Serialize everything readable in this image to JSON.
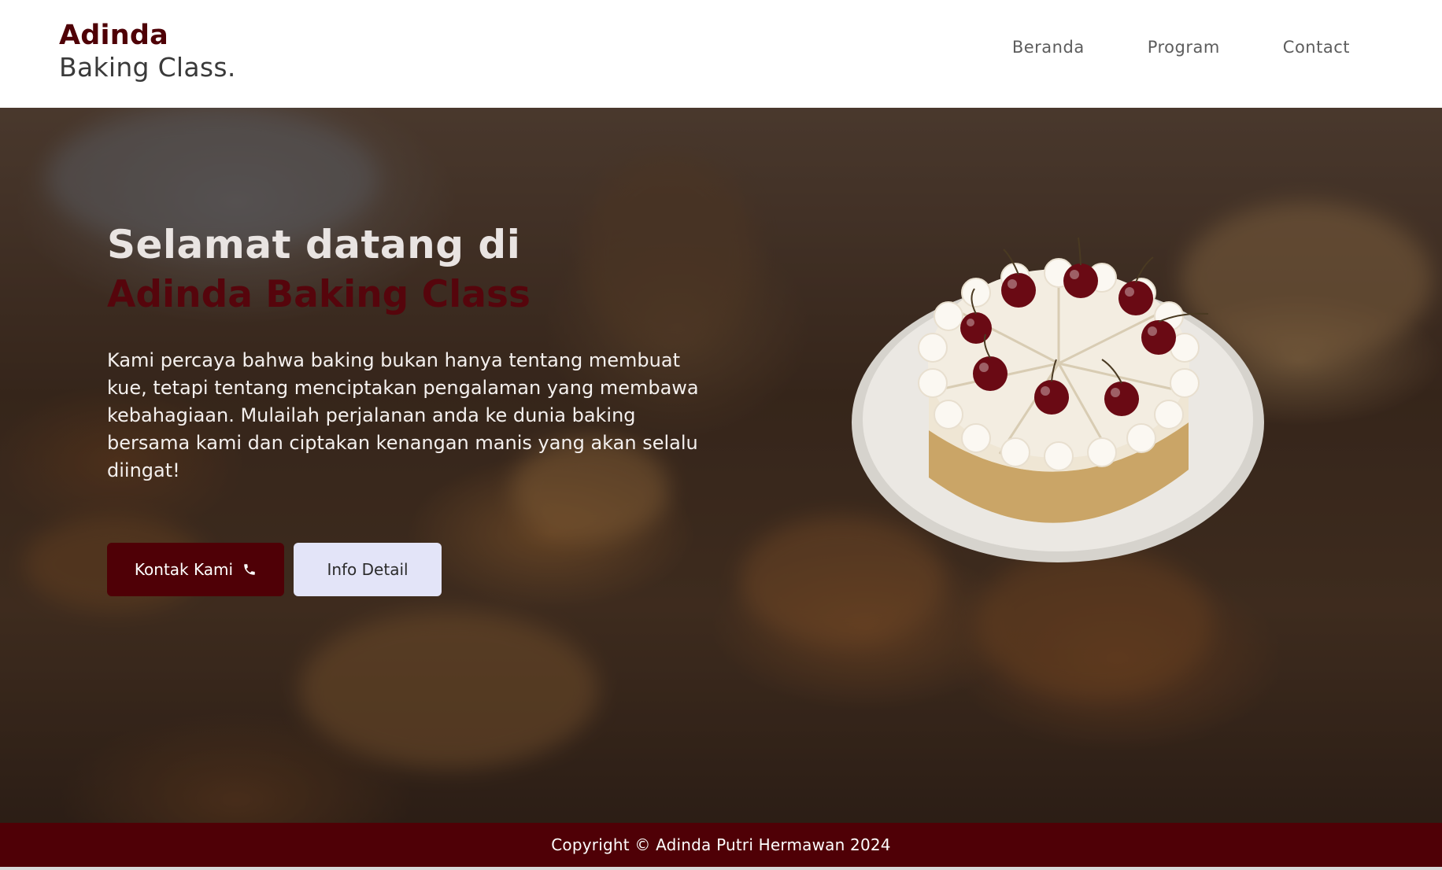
{
  "brand": {
    "line1": "Adinda",
    "line2": "Baking Class."
  },
  "nav": {
    "items": [
      {
        "label": "Beranda"
      },
      {
        "label": "Program"
      },
      {
        "label": "Contact"
      }
    ]
  },
  "hero": {
    "greeting": "Selamat datang di",
    "title": "Adinda Baking Class",
    "description": "Kami percaya bahwa baking bukan hanya tentang membuat kue, tetapi tentang menciptakan pengalaman yang membawa kebahagiaan. Mulailah perjalanan anda ke dunia baking bersama kami dan ciptakan kenangan manis yang akan selalu diingat!",
    "buttons": {
      "contact_label": "Kontak Kami",
      "contact_icon": "phone-icon",
      "detail_label": "Info Detail"
    }
  },
  "footer": {
    "copyright": "Copyright © Adinda Putri Hermawan 2024"
  },
  "colors": {
    "brand": "#4f0006",
    "button_secondary": "#e3e4f8",
    "nav_text": "#5d5d5d"
  }
}
